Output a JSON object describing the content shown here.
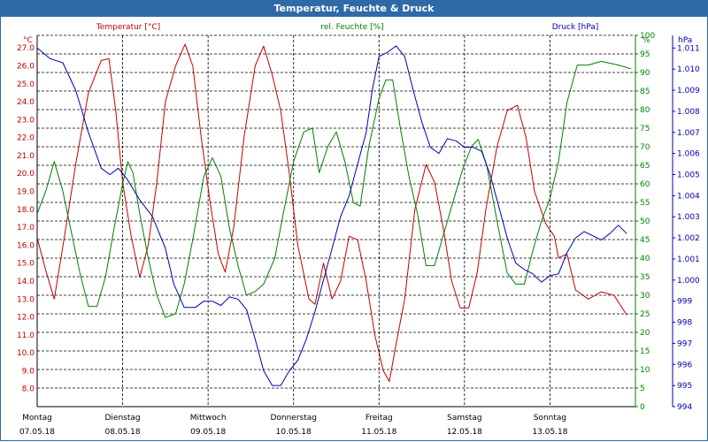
{
  "window": {
    "title": "Temperatur, Feuchte & Druck"
  },
  "colors": {
    "temperature": "#c00000",
    "humidity": "#008000",
    "pressure": "#0000b0",
    "titlebar": "#2e6aa6"
  },
  "chart_data": {
    "type": "line",
    "grid": true,
    "x_range": [
      0,
      7
    ],
    "x_ticks": [
      {
        "x": 0,
        "day": "Montag",
        "date": "07.05.18"
      },
      {
        "x": 1,
        "day": "Dienstag",
        "date": "08.05.18"
      },
      {
        "x": 2,
        "day": "Mittwoch",
        "date": "09.05.18"
      },
      {
        "x": 3,
        "day": "Donnerstag",
        "date": "10.05.18"
      },
      {
        "x": 4,
        "day": "Freitag",
        "date": "11.05.18"
      },
      {
        "x": 5,
        "day": "Samstag",
        "date": "12.05.18"
      },
      {
        "x": 6,
        "day": "Sonntag",
        "date": "13.05.18"
      }
    ],
    "axes": {
      "temperature": {
        "unit": "°C",
        "label": "Temperatur [°C]",
        "range": [
          7.0,
          27.7
        ],
        "tick_start": 8.0,
        "tick_step": 1.0,
        "decimals": 1
      },
      "humidity": {
        "unit": "%",
        "label": "rel. Feuchte [%]",
        "range": [
          0,
          100
        ],
        "tick_start": 0,
        "tick_step": 5,
        "decimals": 0
      },
      "pressure": {
        "unit": "hPa",
        "label": "Druck [hPa]",
        "range": [
          994,
          1011.6
        ],
        "tick_start": 994,
        "tick_step": 1,
        "decimals": 0
      }
    },
    "series": [
      {
        "name": "Temperatur [°C]",
        "axis": "temperature",
        "color": "#c00000",
        "points": [
          [
            0,
            16.4
          ],
          [
            0.1,
            14.6
          ],
          [
            0.2,
            13.0
          ],
          [
            0.32,
            16.5
          ],
          [
            0.45,
            20.5
          ],
          [
            0.6,
            24.5
          ],
          [
            0.75,
            26.3
          ],
          [
            0.84,
            26.4
          ],
          [
            0.92,
            23.5
          ],
          [
            1.0,
            19.5
          ],
          [
            1.1,
            16.5
          ],
          [
            1.2,
            14.2
          ],
          [
            1.3,
            16.0
          ],
          [
            1.4,
            19.5
          ],
          [
            1.5,
            24.0
          ],
          [
            1.62,
            26.0
          ],
          [
            1.73,
            27.2
          ],
          [
            1.82,
            26.0
          ],
          [
            1.92,
            22.0
          ],
          [
            2.02,
            18.5
          ],
          [
            2.12,
            15.5
          ],
          [
            2.2,
            14.5
          ],
          [
            2.3,
            17.0
          ],
          [
            2.42,
            22.0
          ],
          [
            2.55,
            26.0
          ],
          [
            2.65,
            27.1
          ],
          [
            2.75,
            25.5
          ],
          [
            2.85,
            23.5
          ],
          [
            2.95,
            20.0
          ],
          [
            3.05,
            16.0
          ],
          [
            3.18,
            13.0
          ],
          [
            3.25,
            12.7
          ],
          [
            3.35,
            15.0
          ],
          [
            3.45,
            13.0
          ],
          [
            3.55,
            14.0
          ],
          [
            3.65,
            16.5
          ],
          [
            3.75,
            16.3
          ],
          [
            3.85,
            14.0
          ],
          [
            3.95,
            11.0
          ],
          [
            4.05,
            9.0
          ],
          [
            4.12,
            8.4
          ],
          [
            4.2,
            10.5
          ],
          [
            4.3,
            13.0
          ],
          [
            4.42,
            18.0
          ],
          [
            4.55,
            20.5
          ],
          [
            4.65,
            19.5
          ],
          [
            4.75,
            17.0
          ],
          [
            4.85,
            14.0
          ],
          [
            4.95,
            12.5
          ],
          [
            5.05,
            12.5
          ],
          [
            5.15,
            14.5
          ],
          [
            5.25,
            18.0
          ],
          [
            5.38,
            21.5
          ],
          [
            5.5,
            23.5
          ],
          [
            5.62,
            23.8
          ],
          [
            5.72,
            22.0
          ],
          [
            5.82,
            19.0
          ],
          [
            5.95,
            17.2
          ],
          [
            6.05,
            16.5
          ],
          [
            6.1,
            15.3
          ],
          [
            6.2,
            15.5
          ],
          [
            6.3,
            13.5
          ],
          [
            6.45,
            13.0
          ],
          [
            6.6,
            13.4
          ],
          [
            6.75,
            13.2
          ],
          [
            6.9,
            12.1
          ]
        ]
      },
      {
        "name": "rel. Feuchte [%]",
        "axis": "humidity",
        "color": "#008000",
        "points": [
          [
            0,
            52
          ],
          [
            0.1,
            58
          ],
          [
            0.2,
            66
          ],
          [
            0.3,
            58
          ],
          [
            0.4,
            47
          ],
          [
            0.5,
            36
          ],
          [
            0.6,
            27
          ],
          [
            0.7,
            27
          ],
          [
            0.8,
            35
          ],
          [
            0.9,
            48
          ],
          [
            1.0,
            60
          ],
          [
            1.06,
            66
          ],
          [
            1.12,
            63
          ],
          [
            1.2,
            52
          ],
          [
            1.3,
            40
          ],
          [
            1.4,
            30
          ],
          [
            1.5,
            24
          ],
          [
            1.62,
            25
          ],
          [
            1.72,
            33
          ],
          [
            1.82,
            45
          ],
          [
            1.95,
            62
          ],
          [
            2.05,
            67
          ],
          [
            2.15,
            62
          ],
          [
            2.25,
            48
          ],
          [
            2.35,
            38
          ],
          [
            2.45,
            30
          ],
          [
            2.55,
            31
          ],
          [
            2.65,
            33
          ],
          [
            2.78,
            40
          ],
          [
            2.88,
            52
          ],
          [
            3.0,
            66
          ],
          [
            3.12,
            74
          ],
          [
            3.22,
            75
          ],
          [
            3.3,
            63
          ],
          [
            3.4,
            70
          ],
          [
            3.5,
            74
          ],
          [
            3.6,
            66
          ],
          [
            3.7,
            55
          ],
          [
            3.78,
            54
          ],
          [
            3.88,
            70
          ],
          [
            4.0,
            83
          ],
          [
            4.08,
            88
          ],
          [
            4.16,
            88
          ],
          [
            4.25,
            75
          ],
          [
            4.35,
            62
          ],
          [
            4.45,
            52
          ],
          [
            4.55,
            38
          ],
          [
            4.65,
            38
          ],
          [
            4.75,
            46
          ],
          [
            4.85,
            54
          ],
          [
            4.98,
            64
          ],
          [
            5.08,
            70
          ],
          [
            5.16,
            72
          ],
          [
            5.26,
            65
          ],
          [
            5.38,
            50
          ],
          [
            5.5,
            36
          ],
          [
            5.6,
            33
          ],
          [
            5.7,
            33
          ],
          [
            5.8,
            42
          ],
          [
            5.9,
            50
          ],
          [
            6.0,
            56
          ],
          [
            6.1,
            66
          ],
          [
            6.2,
            82
          ],
          [
            6.32,
            92
          ],
          [
            6.45,
            92
          ],
          [
            6.6,
            93
          ],
          [
            6.8,
            92
          ],
          [
            6.95,
            91
          ]
        ]
      },
      {
        "name": "Druck [hPa]",
        "axis": "pressure",
        "color": "#0000b0",
        "points": [
          [
            0,
            1011.0
          ],
          [
            0.15,
            1010.5
          ],
          [
            0.3,
            1010.3
          ],
          [
            0.45,
            1009.0
          ],
          [
            0.6,
            1007.0
          ],
          [
            0.75,
            1005.3
          ],
          [
            0.85,
            1005.0
          ],
          [
            0.95,
            1005.3
          ],
          [
            1.05,
            1004.8
          ],
          [
            1.2,
            1003.8
          ],
          [
            1.35,
            1003.0
          ],
          [
            1.5,
            1001.5
          ],
          [
            1.6,
            999.8
          ],
          [
            1.72,
            998.7
          ],
          [
            1.85,
            998.7
          ],
          [
            1.95,
            999.0
          ],
          [
            2.05,
            999.0
          ],
          [
            2.15,
            998.8
          ],
          [
            2.25,
            999.2
          ],
          [
            2.35,
            999.1
          ],
          [
            2.45,
            998.6
          ],
          [
            2.55,
            997.2
          ],
          [
            2.65,
            995.7
          ],
          [
            2.75,
            995.0
          ],
          [
            2.85,
            995.0
          ],
          [
            2.95,
            995.7
          ],
          [
            3.05,
            996.2
          ],
          [
            3.15,
            997.2
          ],
          [
            3.25,
            998.5
          ],
          [
            3.35,
            1000.0
          ],
          [
            3.45,
            1001.5
          ],
          [
            3.55,
            1003.0
          ],
          [
            3.65,
            1004.0
          ],
          [
            3.75,
            1005.5
          ],
          [
            3.85,
            1007.0
          ],
          [
            3.92,
            1009.0
          ],
          [
            4.0,
            1010.6
          ],
          [
            4.1,
            1010.8
          ],
          [
            4.2,
            1011.1
          ],
          [
            4.3,
            1010.6
          ],
          [
            4.4,
            1009.0
          ],
          [
            4.5,
            1007.5
          ],
          [
            4.6,
            1006.3
          ],
          [
            4.7,
            1006.0
          ],
          [
            4.8,
            1006.7
          ],
          [
            4.9,
            1006.6
          ],
          [
            5.0,
            1006.3
          ],
          [
            5.1,
            1006.3
          ],
          [
            5.2,
            1006.1
          ],
          [
            5.3,
            1005.0
          ],
          [
            5.4,
            1003.5
          ],
          [
            5.5,
            1002.0
          ],
          [
            5.6,
            1000.8
          ],
          [
            5.7,
            1000.5
          ],
          [
            5.8,
            1000.3
          ],
          [
            5.9,
            999.9
          ],
          [
            6.0,
            1000.2
          ],
          [
            6.1,
            1000.3
          ],
          [
            6.2,
            1001.3
          ],
          [
            6.3,
            1002.0
          ],
          [
            6.4,
            1002.3
          ],
          [
            6.5,
            1002.1
          ],
          [
            6.6,
            1001.9
          ],
          [
            6.7,
            1002.2
          ],
          [
            6.8,
            1002.6
          ],
          [
            6.9,
            1002.2
          ]
        ]
      }
    ]
  }
}
